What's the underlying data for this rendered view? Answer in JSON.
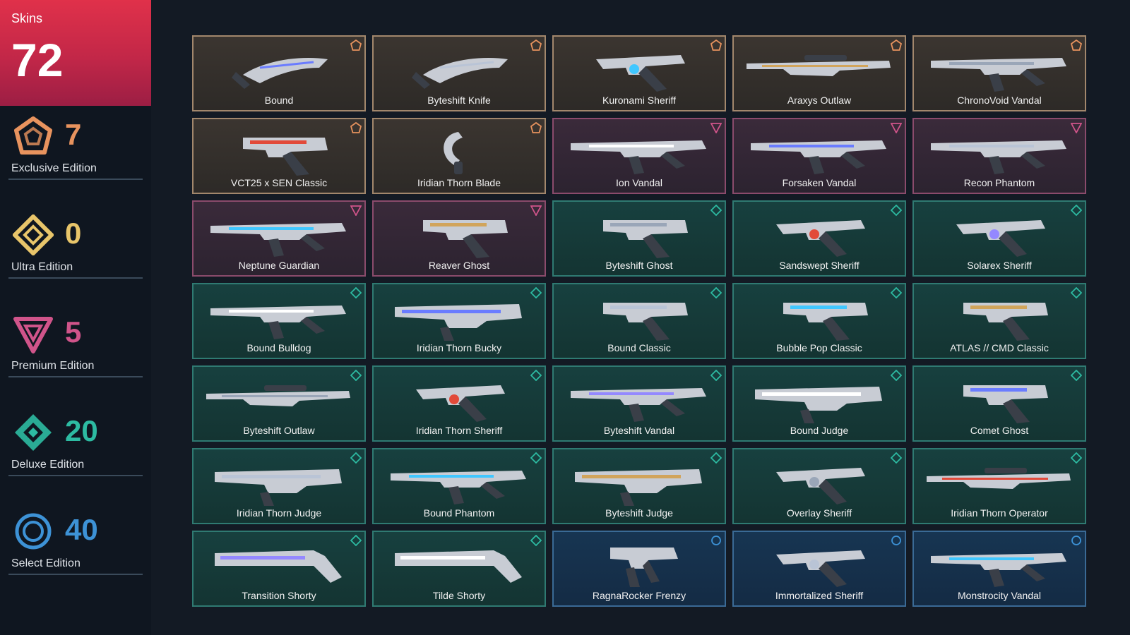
{
  "colors": {
    "exclusive": "#e8935e",
    "ultra": "#e8c56a",
    "premium": "#d0548a",
    "deluxe": "#2dbba2",
    "select": "#3d92d6"
  },
  "summary": {
    "label": "Skins",
    "count": "72"
  },
  "tiers": [
    {
      "key": "exclusive",
      "label": "Exclusive Edition",
      "count": "7",
      "icon": "exclusive-edition-icon"
    },
    {
      "key": "ultra",
      "label": "Ultra Edition",
      "count": "0",
      "icon": "ultra-edition-icon"
    },
    {
      "key": "premium",
      "label": "Premium Edition",
      "count": "5",
      "icon": "premium-edition-icon"
    },
    {
      "key": "deluxe",
      "label": "Deluxe Edition",
      "count": "20",
      "icon": "deluxe-edition-icon"
    },
    {
      "key": "select",
      "label": "Select Edition",
      "count": "40",
      "icon": "select-edition-icon"
    }
  ],
  "skins": [
    {
      "name": "Bound",
      "tier": "exclusive",
      "kind": "knife"
    },
    {
      "name": "Byteshift Knife",
      "tier": "exclusive",
      "kind": "knife"
    },
    {
      "name": "Kuronami Sheriff",
      "tier": "exclusive",
      "kind": "sheriff"
    },
    {
      "name": "Araxys Outlaw",
      "tier": "exclusive",
      "kind": "sniper"
    },
    {
      "name": "ChronoVoid Vandal",
      "tier": "exclusive",
      "kind": "rifle"
    },
    {
      "name": "VCT25 x SEN Classic",
      "tier": "exclusive",
      "kind": "pistol"
    },
    {
      "name": "Iridian Thorn Blade",
      "tier": "exclusive",
      "kind": "blade"
    },
    {
      "name": "Ion Vandal",
      "tier": "premium",
      "kind": "rifle"
    },
    {
      "name": "Forsaken Vandal",
      "tier": "premium",
      "kind": "rifle"
    },
    {
      "name": "Recon Phantom",
      "tier": "premium",
      "kind": "rifle"
    },
    {
      "name": "Neptune Guardian",
      "tier": "premium",
      "kind": "rifle"
    },
    {
      "name": "Reaver Ghost",
      "tier": "premium",
      "kind": "pistol"
    },
    {
      "name": "Byteshift Ghost",
      "tier": "deluxe",
      "kind": "pistol"
    },
    {
      "name": "Sandswept Sheriff",
      "tier": "deluxe",
      "kind": "sheriff"
    },
    {
      "name": "Solarex Sheriff",
      "tier": "deluxe",
      "kind": "sheriff"
    },
    {
      "name": "Bound Bulldog",
      "tier": "deluxe",
      "kind": "rifle"
    },
    {
      "name": "Iridian Thorn Bucky",
      "tier": "deluxe",
      "kind": "shotgun"
    },
    {
      "name": "Bound Classic",
      "tier": "deluxe",
      "kind": "pistol"
    },
    {
      "name": "Bubble Pop Classic",
      "tier": "deluxe",
      "kind": "pistol"
    },
    {
      "name": "ATLAS // CMD Classic",
      "tier": "deluxe",
      "kind": "pistol"
    },
    {
      "name": "Byteshift Outlaw",
      "tier": "deluxe",
      "kind": "sniper"
    },
    {
      "name": "Iridian Thorn Sheriff",
      "tier": "deluxe",
      "kind": "sheriff"
    },
    {
      "name": "Byteshift Vandal",
      "tier": "deluxe",
      "kind": "rifle"
    },
    {
      "name": "Bound Judge",
      "tier": "deluxe",
      "kind": "shotgun"
    },
    {
      "name": "Comet Ghost",
      "tier": "deluxe",
      "kind": "pistol"
    },
    {
      "name": "Iridian Thorn Judge",
      "tier": "deluxe",
      "kind": "shotgun"
    },
    {
      "name": "Bound Phantom",
      "tier": "deluxe",
      "kind": "rifle"
    },
    {
      "name": "Byteshift Judge",
      "tier": "deluxe",
      "kind": "shotgun"
    },
    {
      "name": "Overlay Sheriff",
      "tier": "deluxe",
      "kind": "sheriff"
    },
    {
      "name": "Iridian Thorn Operator",
      "tier": "deluxe",
      "kind": "sniper"
    },
    {
      "name": "Transition Shorty",
      "tier": "deluxe",
      "kind": "shorty"
    },
    {
      "name": "Tilde Shorty",
      "tier": "deluxe",
      "kind": "shorty"
    },
    {
      "name": "RagnaRocker Frenzy",
      "tier": "select",
      "kind": "smg"
    },
    {
      "name": "Immortalized Sheriff",
      "tier": "select",
      "kind": "sheriff"
    },
    {
      "name": "Monstrocity Vandal",
      "tier": "select",
      "kind": "rifle"
    }
  ]
}
